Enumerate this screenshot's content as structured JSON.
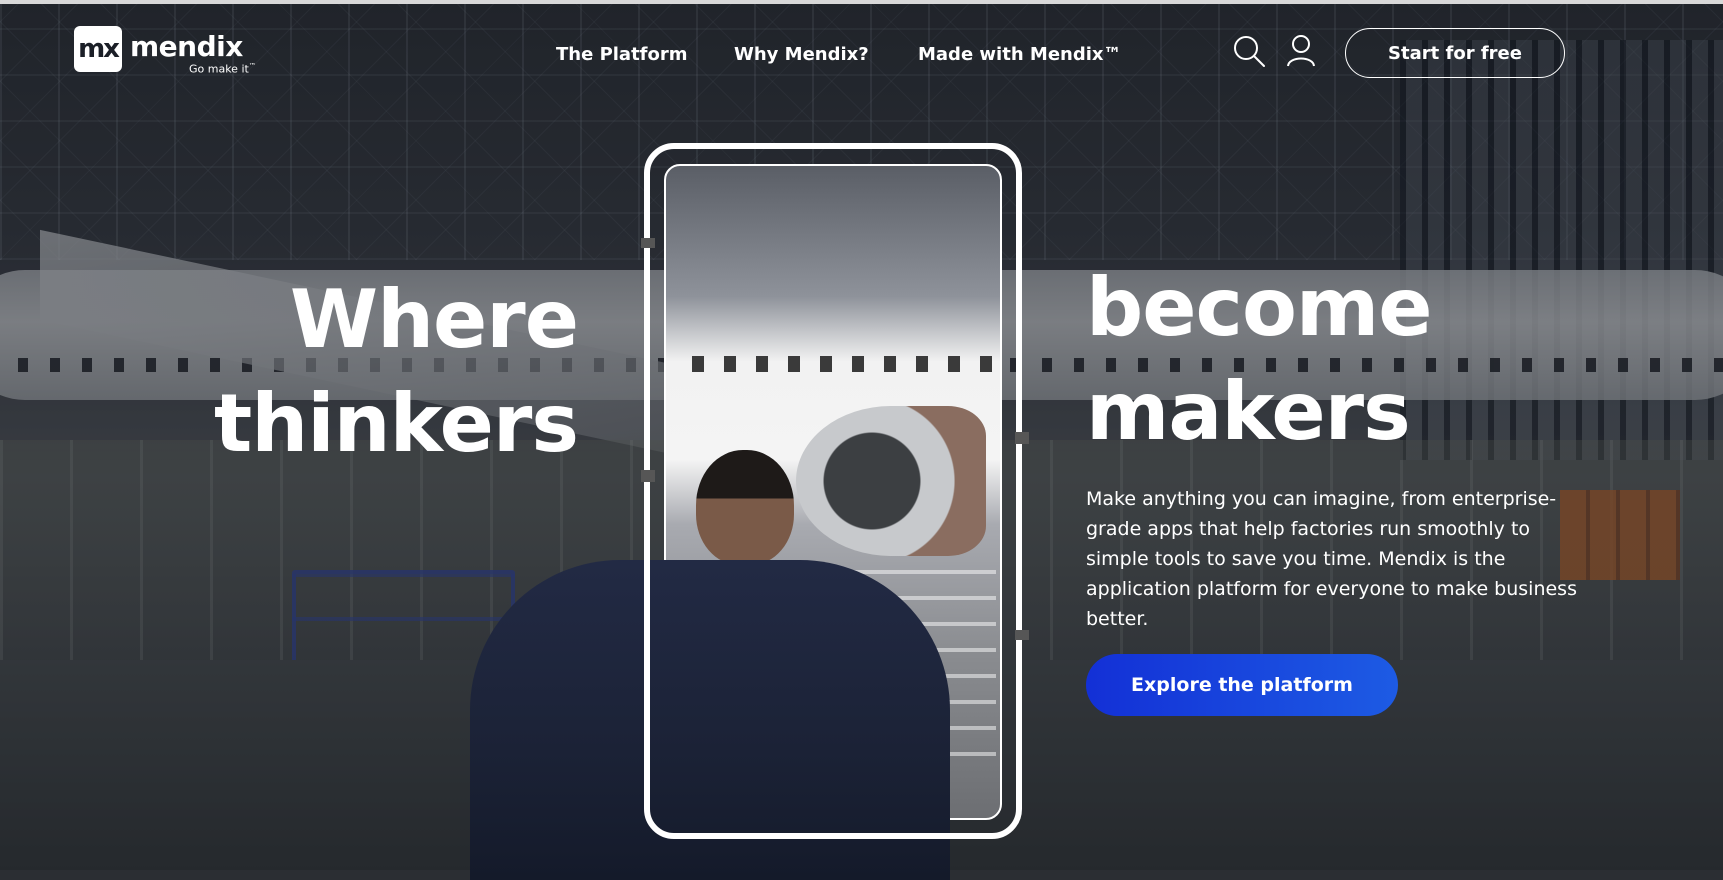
{
  "brand": {
    "logo_mark": "mx",
    "wordmark": "mendix",
    "tagline": "Go make it",
    "tagline_mark": "™"
  },
  "nav": {
    "links": [
      "The Platform",
      "Why Mendix?",
      "Made with Mendix™"
    ],
    "icons": [
      "search-icon",
      "user-icon"
    ],
    "cta_label": "Start for free"
  },
  "hero": {
    "left_lines": [
      "Where",
      "thinkers"
    ],
    "right_lines": [
      "become",
      "makers"
    ],
    "description": "Make anything you can imagine, from enterprise-grade apps that help factories run smoothly to simple tools to save you time. Mendix is the application platform for everyone to make business better.",
    "cta_label": "Explore the platform"
  },
  "colors": {
    "primary_button_start": "#1330d6",
    "primary_button_end": "#1d5be4",
    "text": "#ffffff"
  }
}
